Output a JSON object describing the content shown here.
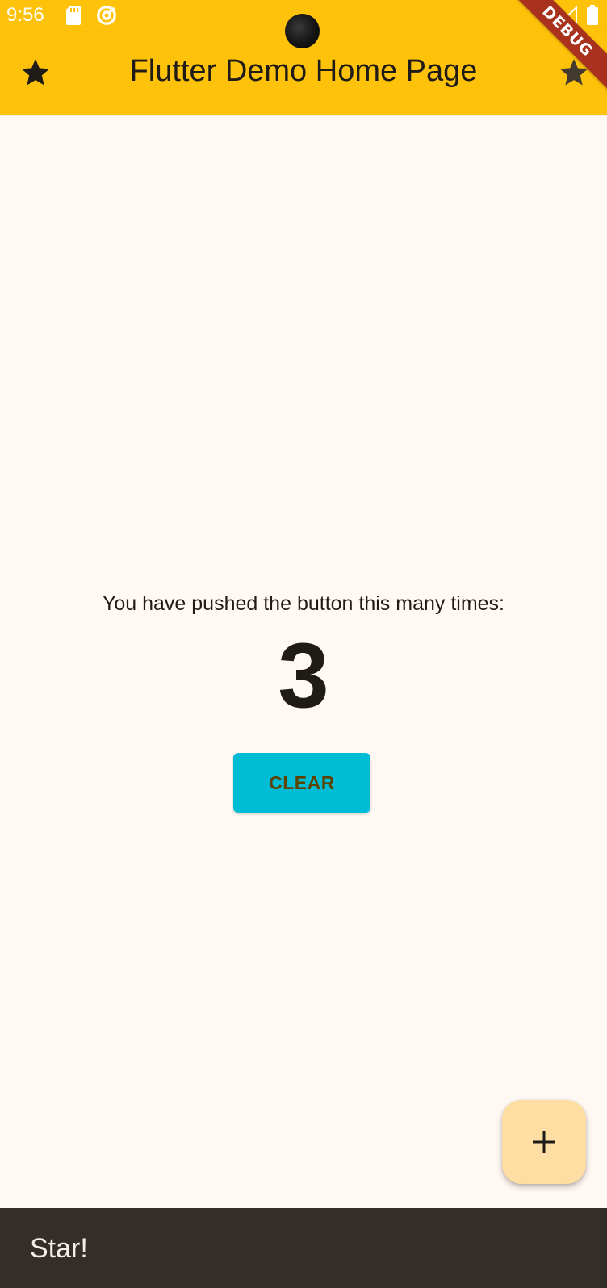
{
  "status_bar": {
    "time": "9:56",
    "icons": [
      "sd-card-icon",
      "at-sign-icon",
      "wifi-icon",
      "signal-icon",
      "battery-icon"
    ]
  },
  "debug_banner": {
    "label": "DEBUG"
  },
  "app_bar": {
    "title": "Flutter Demo Home Page",
    "leading_icon": "star-icon",
    "trailing_icon": "star-icon"
  },
  "main": {
    "counter_label": "You have pushed the button this many times:",
    "counter_value": "3",
    "clear_button_label": "CLEAR"
  },
  "fab": {
    "icon": "plus-icon"
  },
  "snackbar": {
    "message": "Star!"
  },
  "colors": {
    "app_bar": "#FFC20A",
    "background": "#FFF8F3",
    "clear_button": "#00BCD4",
    "clear_button_text": "#5C4300",
    "fab": "#FFDEA3",
    "snackbar": "#342E28",
    "debug_banner": "#A8321D"
  }
}
